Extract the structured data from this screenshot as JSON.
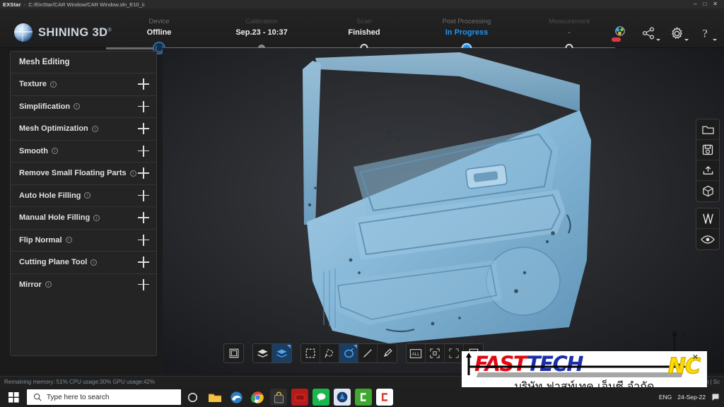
{
  "titlebar": {
    "app_name": "EXStar",
    "separator": "-",
    "path": "C:/EinStar/CAR Window/CAR Window.sln_E10_ii",
    "minimize": "–",
    "maximize": "□",
    "close": "✕"
  },
  "header": {
    "brand": "SHINING 3D",
    "brand_sup": "®",
    "steps": [
      {
        "name": "Device",
        "value": "Offline"
      },
      {
        "name": "Calibration",
        "value": "Sep.23 - 10:37"
      },
      {
        "name": "Scan",
        "value": "Finished"
      },
      {
        "name": "Post Processing",
        "value": "In Progress"
      },
      {
        "name": "Measurement",
        "value": "-"
      }
    ],
    "icons": [
      {
        "name": "project-icon"
      },
      {
        "name": "share-icon"
      },
      {
        "name": "settings-gear-icon"
      },
      {
        "name": "help-question-icon"
      }
    ]
  },
  "sidebar": {
    "title": "Mesh Editing",
    "info_glyph": "i",
    "items": [
      {
        "label": "Texture"
      },
      {
        "label": "Simplification"
      },
      {
        "label": "Mesh Optimization"
      },
      {
        "label": "Smooth"
      },
      {
        "label": "Remove Small Floating Parts"
      },
      {
        "label": "Auto Hole Filling"
      },
      {
        "label": "Manual Hole Filling"
      },
      {
        "label": "Flip Normal"
      },
      {
        "label": "Cutting Plane Tool"
      },
      {
        "label": "Mirror"
      }
    ]
  },
  "viewport": {
    "model_color": "#7fb3d5",
    "background_color": "#2a2c30",
    "gizmo": {
      "y_label": "Y",
      "x_label": "X"
    }
  },
  "right_toolbar": {
    "groups": [
      [
        {
          "name": "open-folder-icon"
        },
        {
          "name": "save-disk-icon"
        },
        {
          "name": "export-upload-icon"
        },
        {
          "name": "cube-model-icon"
        }
      ],
      [
        {
          "name": "mirror-flip-icon"
        },
        {
          "name": "visibility-eye-icon"
        }
      ]
    ]
  },
  "bottom_toolbar": {
    "groups": [
      [
        {
          "name": "bounding-box-icon",
          "active": false
        }
      ],
      [
        {
          "name": "layers-icon",
          "active": false
        },
        {
          "name": "select-through-icon",
          "active": true
        }
      ],
      [
        {
          "name": "rectangle-select-icon",
          "active": false
        },
        {
          "name": "lasso-select-icon",
          "active": false
        },
        {
          "name": "circle-select-icon",
          "active": true
        },
        {
          "name": "line-select-icon",
          "active": false
        },
        {
          "name": "brush-select-icon",
          "active": false
        }
      ],
      [
        {
          "name": "select-all-icon",
          "active": false
        },
        {
          "name": "invert-select-icon",
          "active": false
        },
        {
          "name": "deselect-all-icon",
          "active": false
        },
        {
          "name": "delete-selection-icon",
          "active": false
        }
      ]
    ],
    "select_all_label": "ALL"
  },
  "statusbar": {
    "left": "Remaining memory: 51% CPU usage:30%  GPU usage:42%",
    "right": "Shift+Left Mouse: Select | Ctrl+Left Mouse: Deselect | Left Mouse: Rotate | Middle Mouse: Pan | Sc"
  },
  "watermark": {
    "fast": "FAST",
    "tech": "TECH",
    "nc": "NC",
    "thai": "บริษัท ฟาสท์เทค เอ็นซี จำกัด",
    "close": "✕"
  },
  "taskbar": {
    "start_icon": "windows-start-icon",
    "search_placeholder": "Type here to search",
    "search_icon": "search-icon",
    "cortana_icon": "cortana-circle-icon",
    "apps": [
      {
        "name": "file-explorer-icon",
        "color": "#f3b43b",
        "glyph": ""
      },
      {
        "name": "edge-browser-icon",
        "color": "#2a7fc9",
        "glyph": "e"
      },
      {
        "name": "chrome-browser-icon",
        "color": "#ffffff",
        "glyph": ""
      },
      {
        "name": "store-bag-icon",
        "color": "#2b2b2b",
        "glyph": ""
      },
      {
        "name": "media-app-icon",
        "color": "#b51b1b",
        "glyph": ""
      },
      {
        "name": "line-messenger-icon",
        "color": "#19b84c",
        "glyph": ""
      },
      {
        "name": "blue-sphere-app-icon",
        "color": "#1f3f73",
        "glyph": ""
      },
      {
        "name": "green-app-icon",
        "color": "#3fa832",
        "glyph": "C"
      },
      {
        "name": "red-app-icon",
        "color": "#e03b2f",
        "glyph": "C"
      }
    ],
    "lang": "ENG",
    "date": "24-Sep-22",
    "notification_icon": "notification-flag-icon"
  }
}
